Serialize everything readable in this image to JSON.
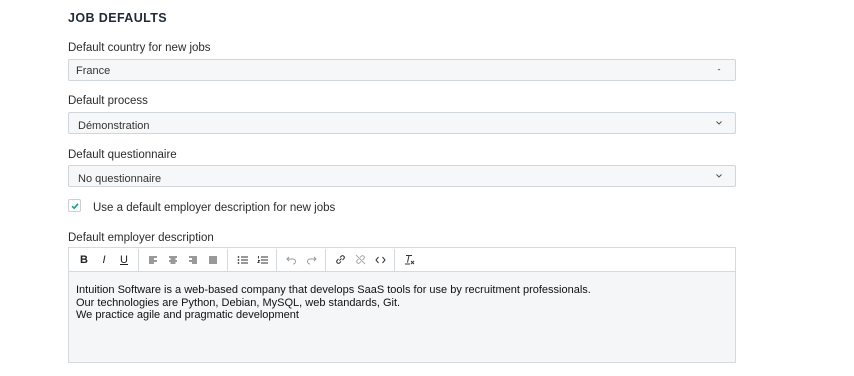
{
  "section": {
    "title": "JOB DEFAULTS"
  },
  "country": {
    "label": "Default country for new jobs",
    "value": "France"
  },
  "process": {
    "label": "Default process",
    "value": "Démonstration"
  },
  "questionnaire": {
    "label": "Default questionnaire",
    "value": "No questionnaire"
  },
  "employer_checkbox": {
    "label": "Use a default employer description for new jobs",
    "checked": true
  },
  "description": {
    "label": "Default employer description",
    "lines": [
      "Intuition Software is a web-based company that develops SaaS tools for use by recruitment professionals.",
      "Our technologies are Python, Debian, MySQL, web standards, Git.",
      "We practice agile and pragmatic development"
    ]
  },
  "toolbar": {
    "bold": "B",
    "italic": "I",
    "underline": "U",
    "icons": [
      "bold-icon",
      "italic-icon",
      "underline-icon",
      "align-left-icon",
      "align-center-icon",
      "align-right-icon",
      "align-justify-icon",
      "bullet-list-icon",
      "numbered-list-icon",
      "undo-icon",
      "redo-icon",
      "link-icon",
      "unlink-icon",
      "code-icon",
      "clear-format-icon"
    ]
  },
  "colors": {
    "accent": "#1aa37a",
    "border": "#cfd6dc",
    "field_bg": "#f5f7f8"
  }
}
